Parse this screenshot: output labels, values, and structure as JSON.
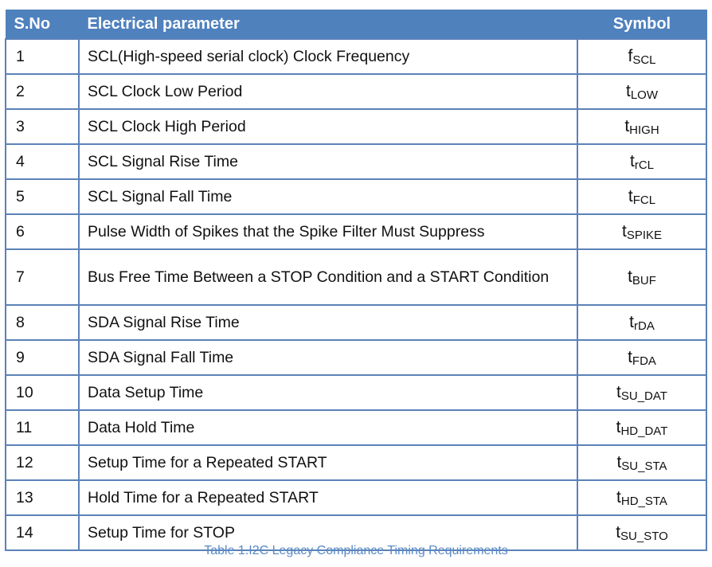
{
  "table": {
    "headers": [
      "S.No",
      "Electrical parameter",
      "Symbol"
    ],
    "rows": [
      {
        "no": "1",
        "param": "SCL(High-speed serial clock) Clock Frequency",
        "sym_base": "f",
        "sym_sub": "SCL"
      },
      {
        "no": "2",
        "param": "SCL Clock Low Period",
        "sym_base": "t",
        "sym_sub": "LOW"
      },
      {
        "no": "3",
        "param": "SCL Clock High Period",
        "sym_base": "t",
        "sym_sub": "HIGH"
      },
      {
        "no": "4",
        "param": "SCL Signal Rise Time",
        "sym_base": "t",
        "sym_sub": "rCL"
      },
      {
        "no": "5",
        "param": "SCL Signal Fall Time",
        "sym_base": "t",
        "sym_sub": "FCL"
      },
      {
        "no": "6",
        "param": "Pulse Width of Spikes that the Spike Filter Must Suppress",
        "sym_base": "t",
        "sym_sub": "SPIKE"
      },
      {
        "no": "7",
        "param": "Bus Free Time Between a STOP Condition and a START Condition",
        "sym_base": "t",
        "sym_sub": "BUF"
      },
      {
        "no": "8",
        "param": "SDA Signal Rise Time",
        "sym_base": "t",
        "sym_sub": "rDA"
      },
      {
        "no": "9",
        "param": "SDA Signal Fall Time",
        "sym_base": "t",
        "sym_sub": "FDA"
      },
      {
        "no": "10",
        "param": "Data Setup Time",
        "sym_base": "t",
        "sym_sub": "SU_DAT"
      },
      {
        "no": "11",
        "param": "Data Hold Time",
        "sym_base": "t",
        "sym_sub": "HD_DAT"
      },
      {
        "no": "12",
        "param": "Setup Time for a Repeated START",
        "sym_base": "t",
        "sym_sub": "SU_STA"
      },
      {
        "no": "13",
        "param": "Hold Time for a Repeated START",
        "sym_base": "t",
        "sym_sub": "HD_STA"
      },
      {
        "no": "14",
        "param": "Setup Time for STOP",
        "sym_base": "t",
        "sym_sub": "SU_STO"
      }
    ]
  },
  "caption": "Table 1.I2C Legacy Compliance Timing Requirements",
  "colors": {
    "header_bg": "#4f81bd",
    "border": "#5b82b8",
    "caption": "#5a8ac6"
  }
}
